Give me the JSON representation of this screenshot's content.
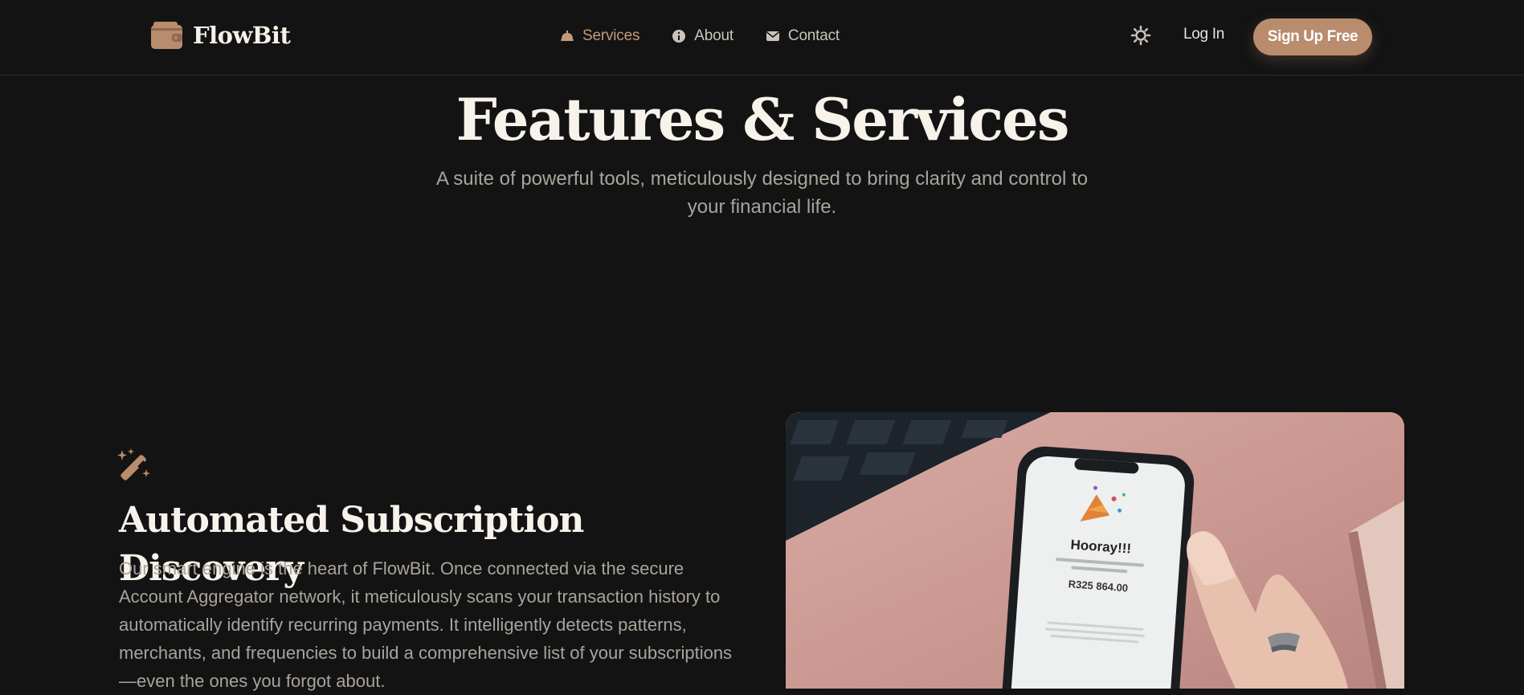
{
  "brand": {
    "name": "FlowBit",
    "icon": "wallet-icon"
  },
  "nav": {
    "links": [
      {
        "label": "Services",
        "icon": "bell-icon",
        "active": true
      },
      {
        "label": "About",
        "icon": "info-icon",
        "active": false
      },
      {
        "label": "Contact",
        "icon": "envelope-icon",
        "active": false
      }
    ],
    "theme_toggle_icon": "sun-icon",
    "login_label": "Log In",
    "signup_label": "Sign Up Free"
  },
  "hero": {
    "title": "Features & Services",
    "subtitle": "A suite of powerful tools, meticulously designed to bring clarity and control to your financial life."
  },
  "feature": {
    "icon": "magic-wand-icon",
    "title": "Automated Subscription Discovery",
    "description": "Our smart engine is the heart of FlowBit. Once connected via the secure Account Aggregator network, it meticulously scans your transaction history to automatically identify recurring payments. It intelligently detects patterns, merchants, and frequencies to build a comprehensive list of your subscriptions—even the ones you forgot about.",
    "image": {
      "phone_heading": "Hooray!!!",
      "phone_amount": "R325 864.00"
    }
  },
  "colors": {
    "background": "#131313",
    "accent": "#b88c6c",
    "accent_text": "#c49a78",
    "heading": "#f7f2ea",
    "body_text": "#a9a39b"
  }
}
